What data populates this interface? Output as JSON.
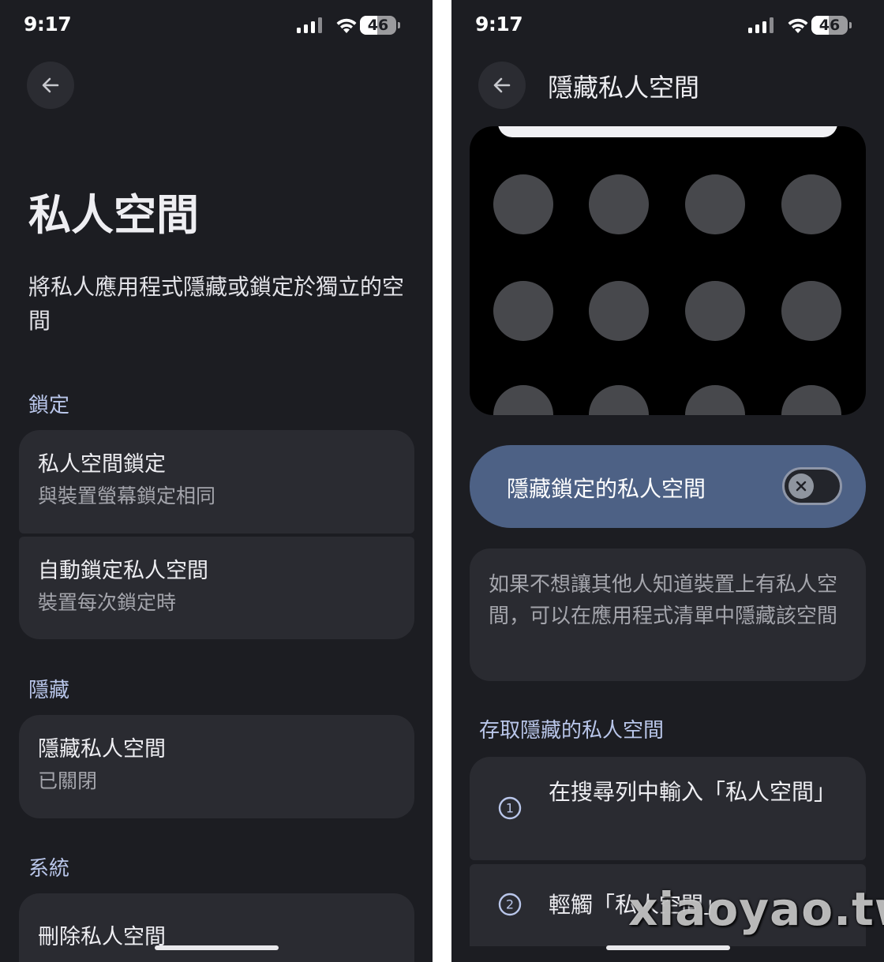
{
  "left": {
    "status": {
      "time": "9:17",
      "battery": "46"
    },
    "title": "私人空間",
    "description": "將私人應用程式隱藏或鎖定於獨立的空間",
    "sections": {
      "lock": {
        "label": "鎖定",
        "items": [
          {
            "title": "私人空間鎖定",
            "subtitle": "與裝置螢幕鎖定相同"
          },
          {
            "title": "自動鎖定私人空間",
            "subtitle": "裝置每次鎖定時"
          }
        ]
      },
      "hide": {
        "label": "隱藏",
        "items": [
          {
            "title": "隱藏私人空間",
            "subtitle": "已關閉"
          }
        ]
      },
      "system": {
        "label": "系統",
        "items": [
          {
            "title": "刪除私人空間"
          }
        ]
      }
    }
  },
  "right": {
    "status": {
      "time": "9:17",
      "battery": "46"
    },
    "title": "隱藏私人空間",
    "toggle": {
      "label": "隱藏鎖定的私人空間",
      "on": false
    },
    "info": "如果不想讓其他人知道裝置上有私人空間，可以在應用程式清單中隱藏該空間",
    "access_section": "存取隱藏的私人空間",
    "steps": [
      {
        "number": "1",
        "text": "在搜尋列中輸入「私人空間」"
      },
      {
        "number": "2",
        "text": "輕觸「私人空間」"
      }
    ]
  },
  "watermark": "xiaoyao.tw",
  "colors": {
    "background": "#1c1d22",
    "card": "#2a2b31",
    "accent_row": "#4d6185",
    "section_label": "#b9c6ea"
  }
}
